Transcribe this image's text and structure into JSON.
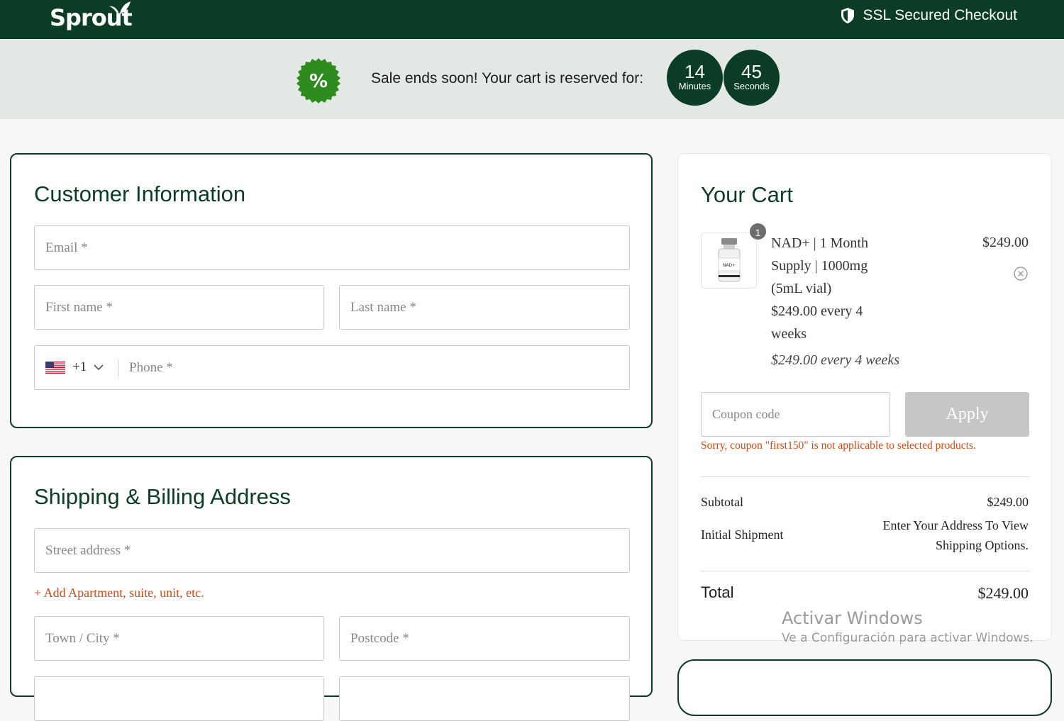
{
  "header": {
    "logo": "Sprout",
    "ssl_label": "SSL Secured Checkout"
  },
  "banner": {
    "badge_symbol": "%",
    "message": "Sale ends soon! Your cart is reserved for:",
    "minutes": "14",
    "minutes_label": "Minutes",
    "seconds": "45",
    "seconds_label": "Seconds"
  },
  "customer": {
    "title": "Customer Information",
    "email_placeholder": "Email *",
    "first_name_placeholder": "First name *",
    "last_name_placeholder": "Last name *",
    "country_code": "+1",
    "phone_placeholder": "Phone *"
  },
  "shipping": {
    "title": "Shipping & Billing Address",
    "street_placeholder": "Street address *",
    "add_apartment": "+ Add Apartment, suite, unit, etc.",
    "city_placeholder": "Town / City *",
    "postcode_placeholder": "Postcode *"
  },
  "cart": {
    "title": "Your Cart",
    "item": {
      "quantity": "1",
      "name_lines": [
        "NAD+ | 1 Month",
        "Supply | 1000mg",
        "(5mL vial)",
        "$249.00 every 4",
        "weeks"
      ],
      "price": "$249.00",
      "recurring": "$249.00 every 4 weeks",
      "vial_label": "NAD+"
    },
    "coupon_placeholder": "Coupon code",
    "apply_label": "Apply",
    "coupon_error": "Sorry, coupon \"first150\" is not applicable to selected products.",
    "subtotal_label": "Subtotal",
    "subtotal_value": "$249.00",
    "shipment_label": "Initial Shipment",
    "shipment_value_lines": [
      "Enter Your Address To View",
      "Shipping Options."
    ],
    "total_label": "Total",
    "total_value": "$249.00"
  },
  "watermark": {
    "line1": "Activar Windows",
    "line2": "Ve a Configuración para activar Windows."
  },
  "colors": {
    "brand_green": "#0b3d26",
    "badge_green": "#2e8b1e",
    "error_orange": "#d9480f",
    "apply_disabled": "#c6c6c6"
  }
}
